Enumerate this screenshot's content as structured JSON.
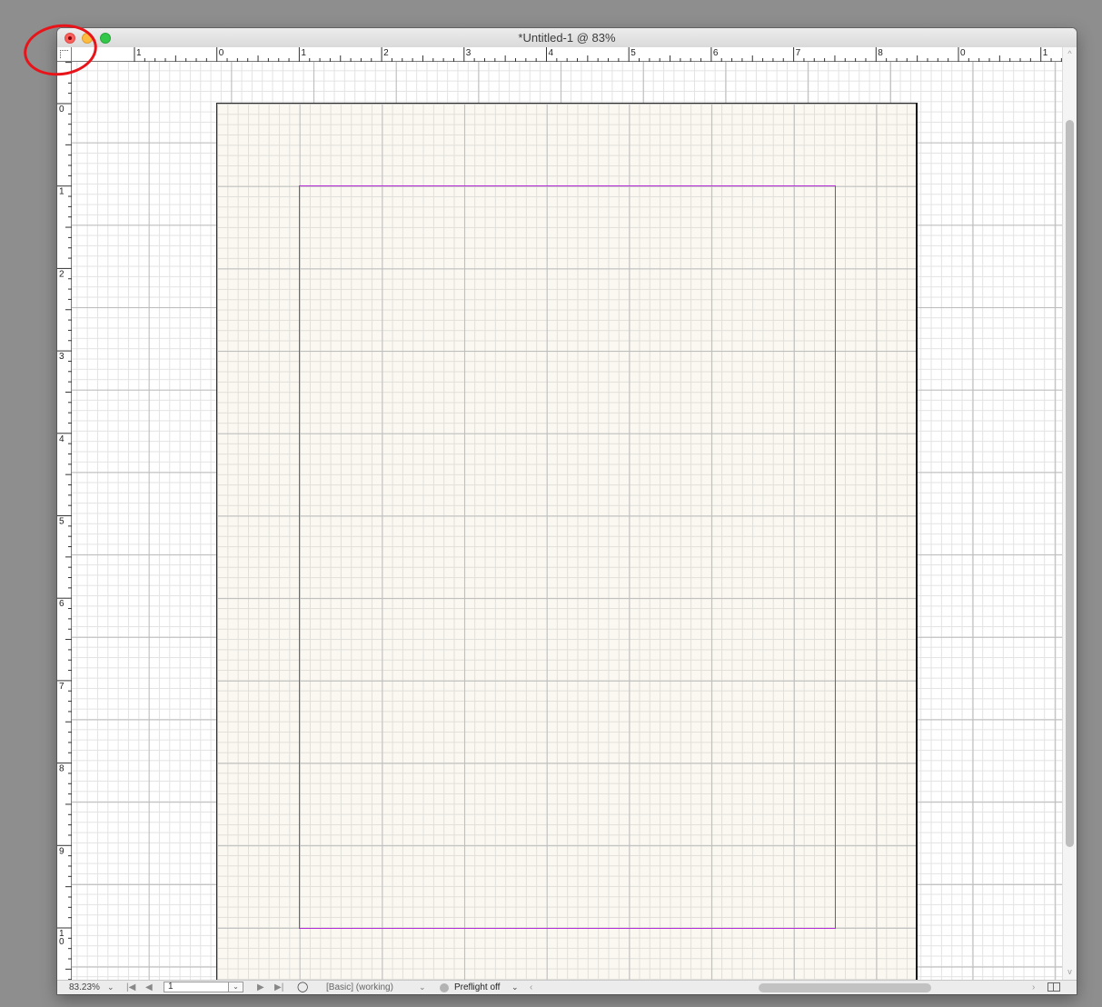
{
  "window": {
    "title": "*Untitled-1 @ 83%"
  },
  "rulers": {
    "horizontal_labels": [
      "1",
      "0",
      "1",
      "2",
      "3",
      "4",
      "5",
      "6",
      "7",
      "8",
      "0",
      "1"
    ],
    "vertical_labels": [
      "0",
      "1",
      "2",
      "3",
      "4",
      "5",
      "6",
      "7",
      "8",
      "9",
      "10"
    ]
  },
  "statusbar": {
    "zoom": "83.23%",
    "page_number": "1",
    "profile": "[Basic] (working)",
    "preflight": "Preflight off"
  },
  "icons": {
    "zoom_dropdown": "chevron-down-icon",
    "first_page": "first-page-icon",
    "prev_page": "prev-page-icon",
    "next_page": "next-page-icon",
    "last_page": "last-page-icon",
    "page_dropdown": "chevron-down-icon",
    "open_tool": "open-page-icon",
    "profile_dropdown": "chevron-down-icon",
    "preflight_status": "preflight-status-icon",
    "preflight_dropdown": "chevron-down-icon",
    "scroll_left": "chevron-left-icon",
    "scroll_right": "chevron-right-icon",
    "split_window": "split-window-icon"
  },
  "colors": {
    "margin_guide": "#b42dd6",
    "annotation": "#e8141a",
    "close_button": "#fc605c",
    "minimize_button": "#fdbc40",
    "zoom_button": "#34c84a"
  }
}
